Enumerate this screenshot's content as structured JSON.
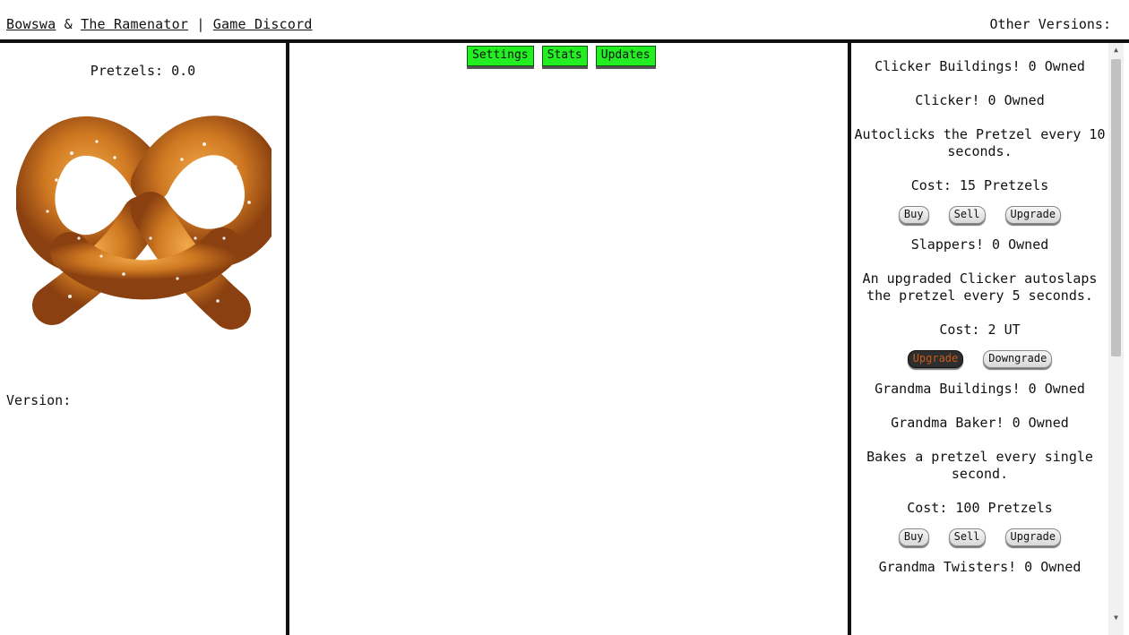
{
  "header": {
    "link_authors": "Bowswa",
    "amp": " & ",
    "link_ramenator": "The Ramenator",
    "sep": " | ",
    "link_discord": "Game Discord",
    "other_versions": "Other Versions:"
  },
  "left": {
    "pretzels_label": "Pretzels: 0.0",
    "version_label": "Version:"
  },
  "tabs": {
    "settings": "Settings",
    "stats": "Stats",
    "updates": "Updates"
  },
  "shop": {
    "clicker_buildings": "Clicker Buildings! 0 Owned",
    "clicker_title": "Clicker! 0 Owned",
    "clicker_desc": "Autoclicks the Pretzel every 10 seconds.",
    "clicker_cost": "Cost: 15 Pretzels",
    "slappers_title": "Slappers! 0 Owned",
    "slappers_desc": "An upgraded Clicker autoslaps the pretzel every 5 seconds.",
    "slappers_cost": "Cost: 2 UT",
    "grandma_buildings": "Grandma Buildings! 0 Owned",
    "grandma_baker_title": "Grandma Baker! 0 Owned",
    "grandma_baker_desc": "Bakes a pretzel every single second.",
    "grandma_baker_cost": "Cost: 100 Pretzels",
    "grandma_twisters_title": "Grandma Twisters! 0 Owned",
    "buy": "Buy",
    "sell": "Sell",
    "upgrade": "Upgrade",
    "downgrade": "Downgrade"
  },
  "colors": {
    "tab_bg": "#22ee22",
    "pretzel": "#c8741f",
    "salt": "#ffffff",
    "active_upgrade_text": "#c85a1a"
  },
  "icons": {
    "pretzel": "pretzel-icon",
    "scroll_up": "scroll-up-arrow-icon",
    "scroll_down": "scroll-down-arrow-icon"
  }
}
